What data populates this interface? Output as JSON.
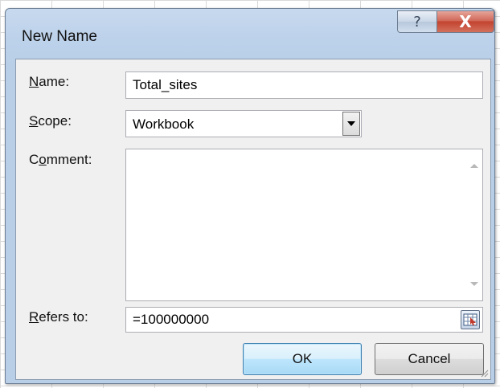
{
  "dialog": {
    "title": "New Name",
    "help_glyph": "?",
    "close_glyph": "X"
  },
  "fields": {
    "name": {
      "label_accel": "N",
      "label_rest": "ame:",
      "value": "Total_sites"
    },
    "scope": {
      "label_accel": "S",
      "label_rest": "cope:",
      "value": "Workbook"
    },
    "comment": {
      "label_pre": "C",
      "label_accel": "o",
      "label_rest": "mment:",
      "value": ""
    },
    "refers_to": {
      "label_accel": "R",
      "label_rest": "efers to:",
      "value": "=100000000"
    }
  },
  "buttons": {
    "ok": "OK",
    "cancel": "Cancel"
  },
  "icons": {
    "dropdown": "chevron-down-icon",
    "scroll_up": "scroll-up-icon",
    "scroll_down": "scroll-down-icon",
    "collapse_dialog": "range-select-icon",
    "resize": "resize-grip-icon"
  },
  "colors": {
    "title_gradient": "#bcd1ea",
    "close_red": "#c24430",
    "ok_blue": "#bee6fd",
    "client_bg": "#f0f0f0"
  }
}
